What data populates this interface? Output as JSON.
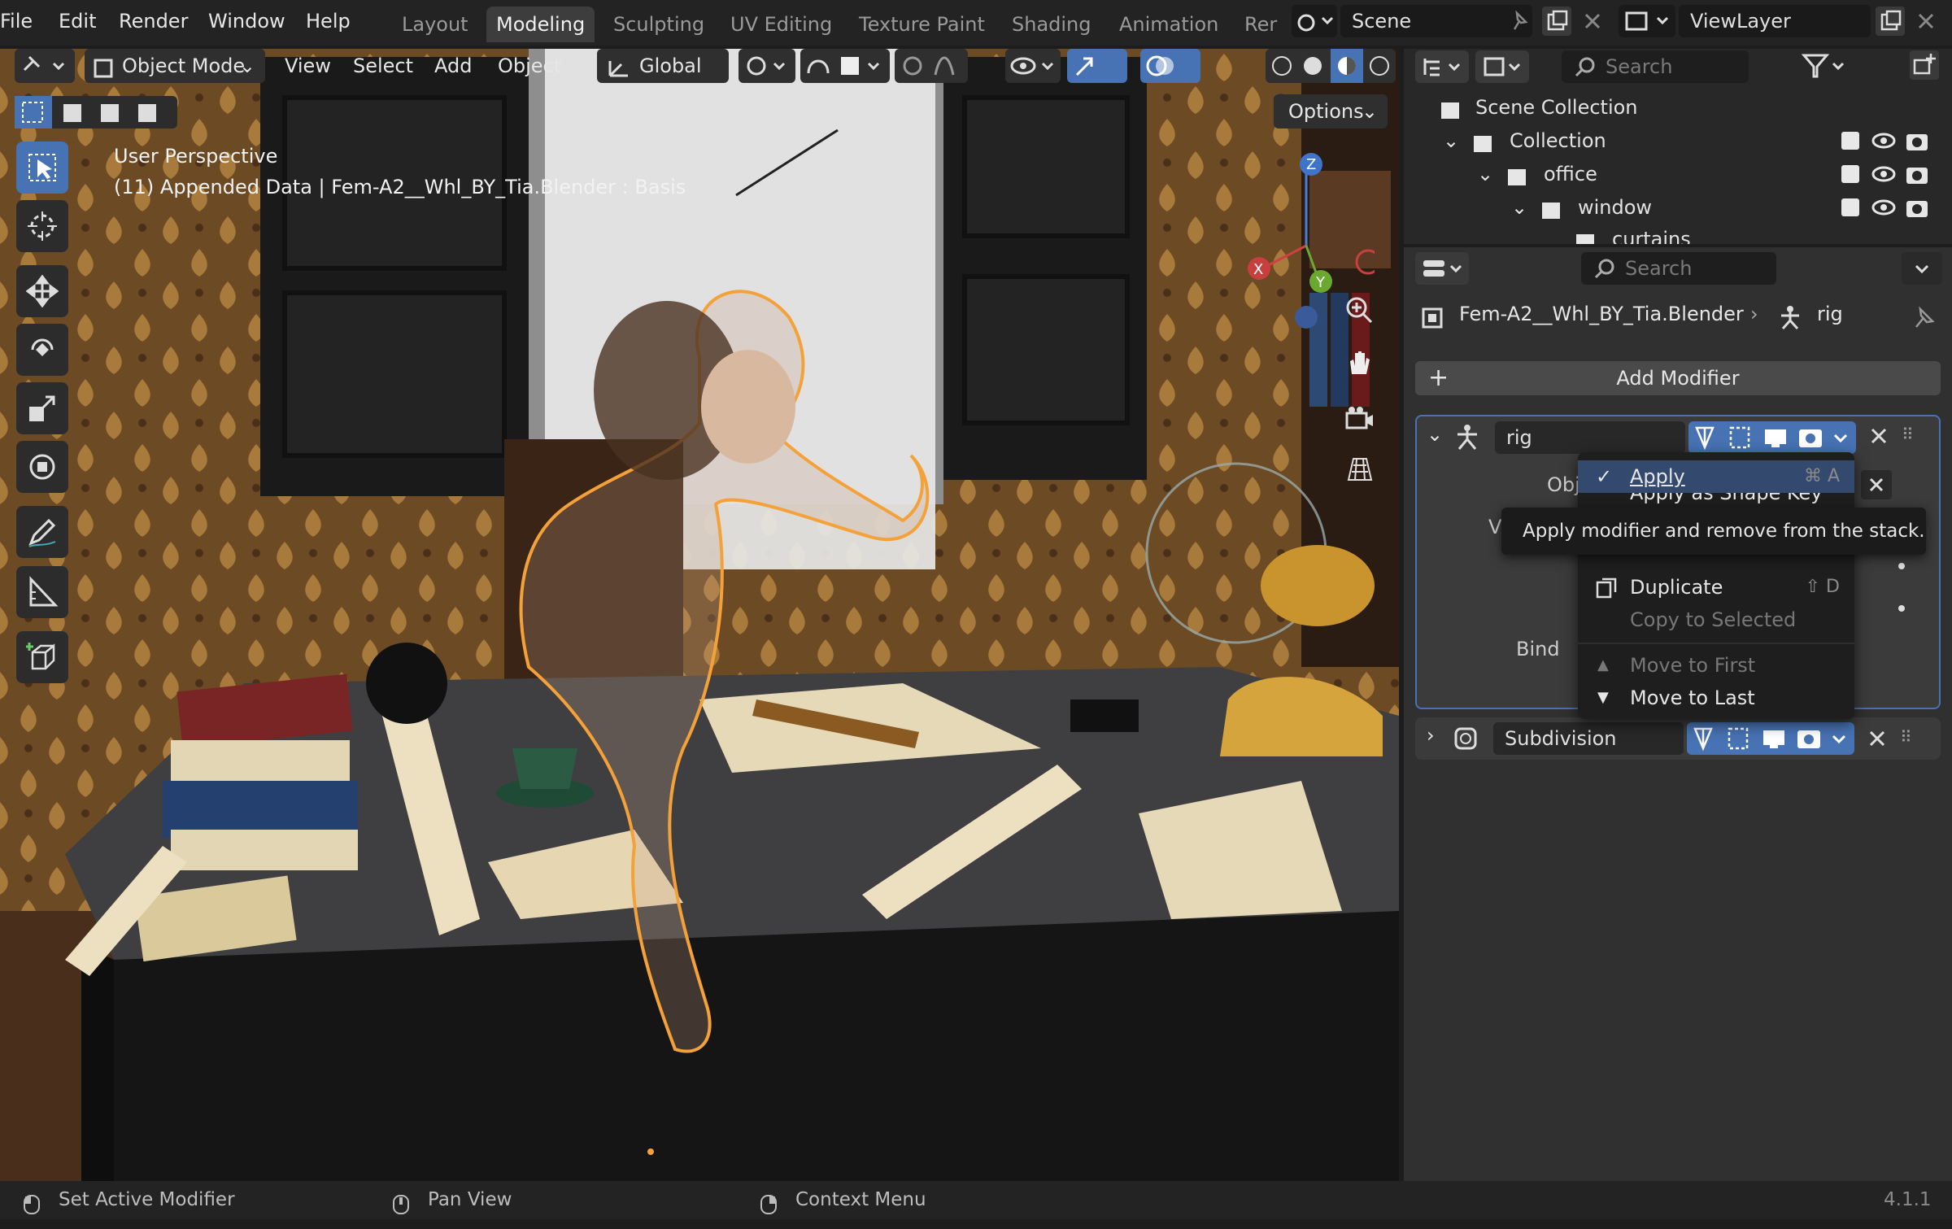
{
  "menubar": {
    "items": [
      "File",
      "Edit",
      "Render",
      "Window",
      "Help"
    ]
  },
  "workspaces": {
    "tabs": [
      "Layout",
      "Modeling",
      "Sculpting",
      "UV Editing",
      "Texture Paint",
      "Shading",
      "Animation",
      "Rer"
    ],
    "active": "Modeling"
  },
  "scene": {
    "name": "Scene",
    "view_layer": "ViewLayer"
  },
  "viewport": {
    "header": {
      "mode": "Object Mode",
      "view": "View",
      "select": "Select",
      "add": "Add",
      "object": "Object",
      "orientation": "Global",
      "options": "Options"
    },
    "overlay_text": {
      "line1": "User Perspective",
      "line2": "(11) Appended Data | Fem-A2__Whl_BY_Tia.Blender : Basis"
    },
    "gizmo": {
      "x": "X",
      "y": "Y",
      "z": "Z"
    }
  },
  "outliner": {
    "search_placeholder": "Search",
    "rows": [
      {
        "label": "Scene Collection"
      },
      {
        "label": "Collection"
      },
      {
        "label": "office"
      },
      {
        "label": "window"
      },
      {
        "label": "curtains"
      }
    ]
  },
  "properties": {
    "search_placeholder": "Search",
    "breadcrumb": {
      "object": "Fem-A2__Whl_BY_Tia.Blender",
      "modifier": "rig"
    },
    "add_modifier": "Add Modifier",
    "modifiers": [
      {
        "name": "rig",
        "expanded": true,
        "fields": {
          "obj": "Obj",
          "v": "V",
          "bind": "Bind"
        }
      },
      {
        "name": "Subdivision",
        "expanded": false
      }
    ]
  },
  "context_menu": {
    "items": [
      {
        "label": "Apply",
        "shortcut": "⌘ A",
        "enabled": true
      },
      {
        "label": "Apply as Shape Key",
        "shortcut": "",
        "enabled": true
      },
      {
        "label": "Duplicate",
        "shortcut": "⇧ D",
        "enabled": true
      },
      {
        "label": "Copy to Selected",
        "shortcut": "",
        "enabled": false
      },
      {
        "label": "Move to First",
        "shortcut": "",
        "enabled": false
      },
      {
        "label": "Move to Last",
        "shortcut": "",
        "enabled": true
      }
    ],
    "tooltip": "Apply modifier and remove from the stack."
  },
  "statusbar": {
    "left": "Set Active Modifier",
    "middle": "Pan View",
    "right": "Context Menu",
    "version": "4.1.1"
  },
  "colors": {
    "accent": "#4772b3",
    "selection_outline": "#f5a13a",
    "wallpaper": "#6b4a24",
    "desk": "#3c3c3e"
  }
}
